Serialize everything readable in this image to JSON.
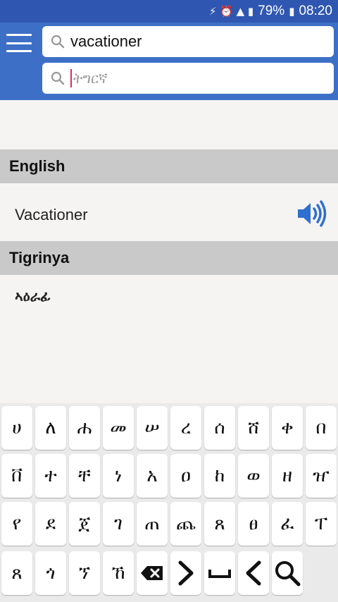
{
  "statusbar": {
    "battery": "79%",
    "time": "08:20"
  },
  "search": {
    "english_value": "vacationer",
    "tigrinya_placeholder": "ትግርኛ"
  },
  "sections": [
    {
      "heading": "English",
      "text": "Vacationer"
    },
    {
      "heading": "Tigrinya",
      "text": "ኣዕራፊ"
    }
  ],
  "keyboard": {
    "row1": [
      "ሀ",
      "ለ",
      "ሐ",
      "መ",
      "ሠ",
      "ረ",
      "ሰ",
      "ሸ",
      "ቀ",
      "በ"
    ],
    "row2": [
      "ቨ",
      "ተ",
      "ቸ",
      "ነ",
      "አ",
      "ዐ",
      "ከ",
      "ወ",
      "ዘ",
      "ዠ"
    ],
    "row3": [
      "የ",
      "ደ",
      "ጀ",
      "ገ",
      "ጠ",
      "ጨ",
      "ጸ",
      "ፀ",
      "ፈ",
      "ፐ"
    ],
    "row4": [
      "ጸ",
      "ጎ",
      "ኘ",
      "ኸ"
    ],
    "icons": [
      "backspace-icon",
      "chevron-right-icon",
      "space-icon",
      "chevron-left-icon",
      "search-icon"
    ]
  },
  "colors": {
    "header": "#3d6fc6",
    "statusbar": "#2f57b2",
    "accent": "#2f6fd0",
    "caret": "#d9286a"
  }
}
